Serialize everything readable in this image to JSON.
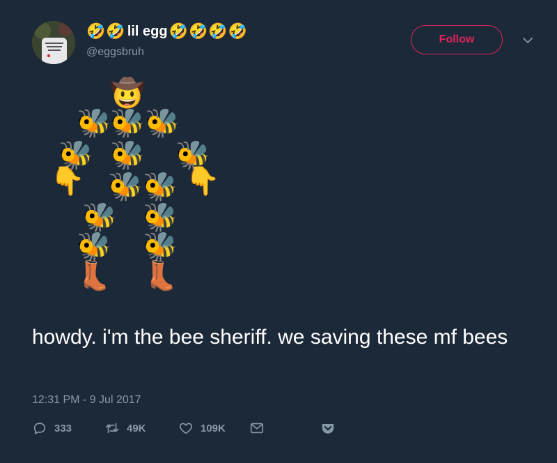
{
  "tweet": {
    "display_name": "lil egg",
    "name_prefix_emoji": [
      "🤣",
      "🤣"
    ],
    "name_suffix_emoji": [
      "🤣",
      "🤣",
      "🤣",
      "🤣"
    ],
    "handle": "@eggsbruh",
    "follow_label": "Follow",
    "text": "howdy. i'm the bee sheriff. we saving these mf bees",
    "timestamp": "12:31 PM - 9 Jul 2017",
    "reply_count": "333",
    "retweet_count": "49K",
    "like_count": "109K"
  },
  "art": {
    "hat_face": "🤠",
    "bee": "🐝",
    "pointing_hand": "👇",
    "boot": "👢"
  },
  "colors": {
    "background": "#1c2938",
    "accent": "#e0245e",
    "muted": "#8899a6",
    "text": "#ffffff"
  },
  "icons": [
    "reply-icon",
    "retweet-icon",
    "like-icon",
    "direct-message-icon",
    "pocket-icon",
    "chevron-down-icon"
  ]
}
